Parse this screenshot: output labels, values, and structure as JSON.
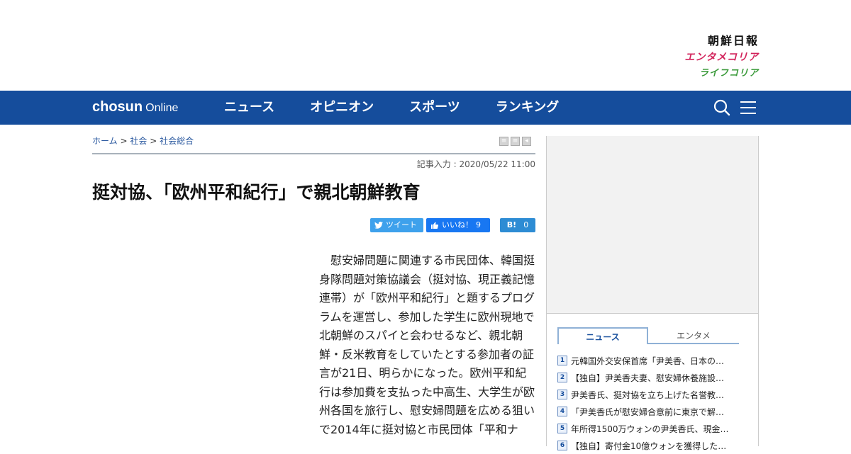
{
  "brand": {
    "main": "朝鮮日報",
    "enta": "エンタメコリア",
    "life": "ライフコリア"
  },
  "nav": {
    "logo_bold": "chosun",
    "logo_sub": "Online",
    "items": [
      "ニュース",
      "オピニオン",
      "スポーツ",
      "ランキング"
    ]
  },
  "breadcrumb": {
    "home": "ホーム",
    "sep": ">",
    "level1": "社会",
    "level2": "社会総合"
  },
  "article": {
    "date": "記事入力 : 2020/05/22 11:00",
    "title": "挺対協、「欧州平和紀行」で親北朝鮮教育",
    "body": "慰安婦問題に関連する市民団体、韓国挺身隊問題対策協議会（挺対協、現正義記憶連帯）が「欧州平和紀行」と題するプログラムを運営し、参加した学生に欧州現地で北朝鮮のスパイと会わせるなど、親北朝鮮・反米教育をしていたとする参加者の証言が21日、明らかになった。欧州平和紀行は参加費を支払った中高生、大学生が欧州各国を旅行し、慰安婦問題を広める狙いで2014年に挺対協と市民団体「平和ナ"
  },
  "share": {
    "tweet_label": "ツイート",
    "like_label": "いいね！",
    "like_count": "9",
    "hatena_label": "B!",
    "hatena_count": "0"
  },
  "sidebar": {
    "tabs": [
      "ニュース",
      "エンタメ"
    ],
    "ranking": [
      {
        "num": "1",
        "text": "元韓国外交安保首席「尹美香、日本の…"
      },
      {
        "num": "2",
        "text": "【独自】尹美香夫妻、慰安婦休養施設…"
      },
      {
        "num": "3",
        "text": "尹美香氏、挺対協を立ち上げた名誉教…"
      },
      {
        "num": "4",
        "text": "「尹美香氏が慰安婦合意前に東京で解…"
      },
      {
        "num": "5",
        "text": "年所得1500万ウォンの尹美香氏、現金…"
      },
      {
        "num": "6",
        "text": "【独自】寄付金10億ウォンを獲得した…"
      }
    ]
  },
  "colors": {
    "nav_bg": "#154d9c",
    "enta": "#d2235b",
    "life": "#3a9a3a",
    "tweet": "#3ea1ec",
    "facebook": "#1877f2",
    "hatena": "#2d8cd4"
  }
}
